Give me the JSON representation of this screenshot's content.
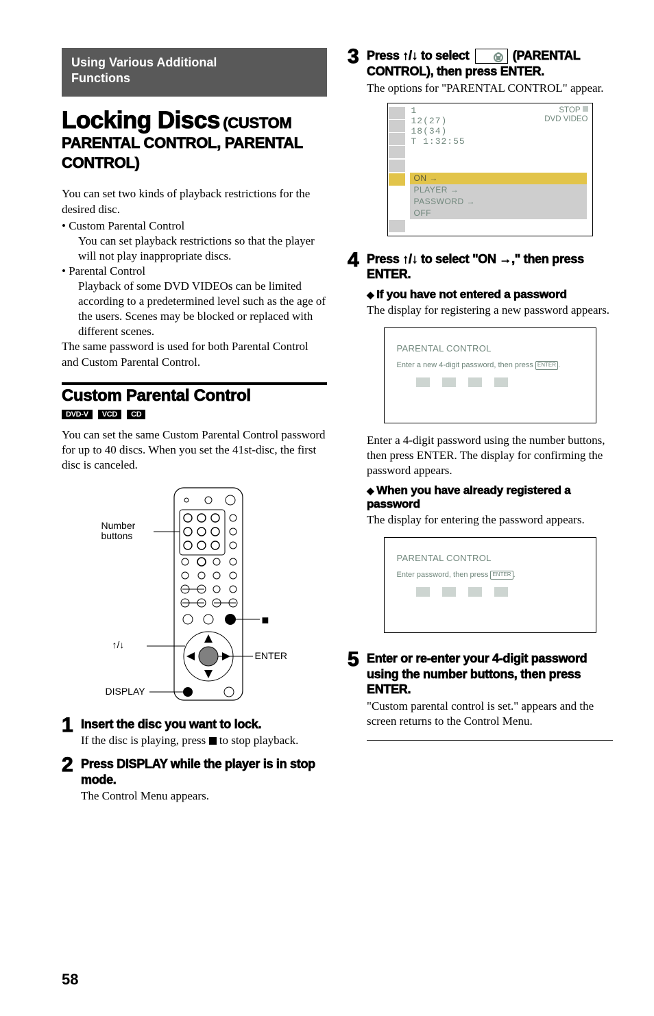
{
  "header": {
    "section_title_line1": "Using Various Additional",
    "section_title_line2": "Functions"
  },
  "title": {
    "main": "Locking Discs",
    "sub_inline": "(CUSTOM",
    "sub_line2": "PARENTAL CONTROL, PARENTAL",
    "sub_line3": "CONTROL)"
  },
  "intro": {
    "p1": "You can set two kinds of playback restrictions for the desired disc.",
    "b1_title": "Custom Parental Control",
    "b1_desc": "You can set playback restrictions so that the player will not play inappropriate discs.",
    "b2_title": "Parental Control",
    "b2_desc": "Playback of some DVD VIDEOs can be limited according to a predetermined level such as the age of the users. Scenes may be blocked or replaced with different scenes.",
    "p2": "The same password is used for both Parental Control and Custom Parental Control."
  },
  "custom": {
    "heading": "Custom Parental Control",
    "badges": [
      "DVD-V",
      "VCD",
      "CD"
    ],
    "desc": "You can set the same Custom Parental Control password for up to 40 discs. When you set the 41st-disc, the first disc is canceled."
  },
  "remote_labels": {
    "number": "Number buttons",
    "arrows": "↑/↓",
    "display": "DISPLAY",
    "stop": "■",
    "enter": "ENTER"
  },
  "steps_left": {
    "s1_head": "Insert the disc you want to lock.",
    "s1_desc_a": "If the disc is playing, press ",
    "s1_desc_b": " to stop playback.",
    "s2_head": "Press DISPLAY while the player is in stop mode.",
    "s2_desc": "The Control Menu appears."
  },
  "steps_right": {
    "s3_head_a": "Press ↑/↓ to select ",
    "s3_head_b": " (PARENTAL CONTROL), then press ENTER.",
    "s3_desc": "The options for \"PARENTAL CONTROL\" appear.",
    "s4_head": "Press ↑/↓ to select \"ON →,\" then press ENTER.",
    "s4_d1_head": "If you have not entered a password",
    "s4_d1_desc": "The display for registering a new password appears.",
    "s4_mid": "Enter a 4-digit password using the number buttons, then press ENTER. The display for confirming the password appears.",
    "s4_d2_head": "When you have already registered a password",
    "s4_d2_desc": "The display for entering the password appears.",
    "s5_head": "Enter or re-enter your 4-digit password using the number buttons, then press ENTER.",
    "s5_desc": "\"Custom parental control is set.\" appears and the screen returns to the Control Menu."
  },
  "osd": {
    "line1": "1",
    "line2": "12(27)",
    "line3": "18(34)",
    "line4": "T    1:32:55",
    "status1": "STOP",
    "status2": "DVD VIDEO",
    "menu": [
      "ON →",
      "PLAYER →",
      "PASSWORD →",
      "OFF"
    ]
  },
  "panel1": {
    "title": "PARENTAL CONTROL",
    "text": "Enter a new 4-digit password, then press ",
    "enter": "ENTER",
    "dot": "."
  },
  "panel2": {
    "title": "PARENTAL CONTROL",
    "text": "Enter password, then press ",
    "enter": "ENTER",
    "dot": "."
  },
  "page_number": "58"
}
